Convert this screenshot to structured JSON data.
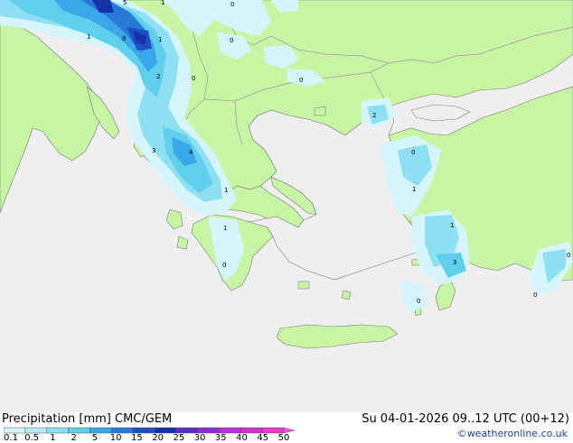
{
  "footer": {
    "title_left": "Precipitation [mm]  CMC/GEM",
    "title_right": "Su 04-01-2026 09..12 UTC (00+12)",
    "credit": "©weatheronline.co.uk"
  },
  "legend": {
    "ticks": [
      "0.1",
      "0.5",
      "1",
      "2",
      "5",
      "10",
      "15",
      "20",
      "25",
      "30",
      "35",
      "40",
      "45",
      "50"
    ],
    "colors": [
      "#d4f5fb",
      "#b6ecf7",
      "#8fdff2",
      "#5fcfeb",
      "#3aa8e8",
      "#2878d8",
      "#1e4fc2",
      "#1632a8",
      "#5a2ec2",
      "#8a2ed4",
      "#b82ed8",
      "#d42ed0",
      "#e63ac8",
      "#f05ad8"
    ]
  },
  "colors": {
    "sea": "#efefef",
    "land": "#c8f5a3",
    "border": "#9a9a9a",
    "coast": "#777777"
  },
  "map_labels": [
    "5",
    "1",
    "0",
    "1",
    "8",
    "1",
    "2",
    "0",
    "0",
    "0",
    "2",
    "3",
    "4",
    "0",
    "1",
    "1",
    "1",
    "1",
    "0",
    "3",
    "0",
    "0",
    "0"
  ]
}
